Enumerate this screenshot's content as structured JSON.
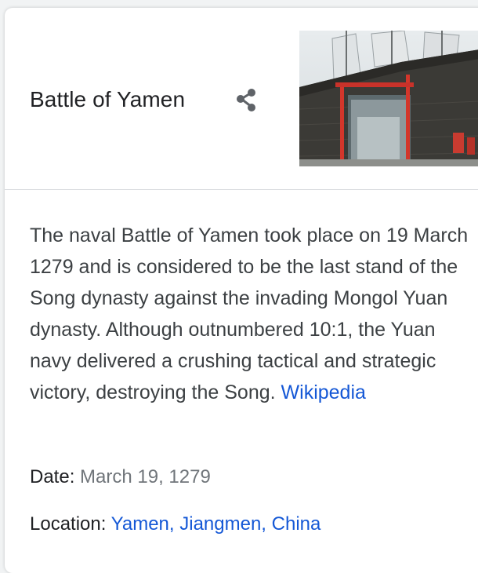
{
  "panel": {
    "title": "Battle of Yamen",
    "share_icon": "share-icon",
    "image_alt": "Yamen battle site gate"
  },
  "description": {
    "text": "The naval Battle of Yamen took place on 19 March 1279 and is considered to be the last stand of the Song dynasty against the invading Mongol Yuan dynasty. Although outnumbered 10:1, the Yuan navy delivered a crushing tactical and strategic victory, destroying the Song.",
    "source_link": "Wikipedia"
  },
  "facts": {
    "date_label": "Date:",
    "date_value": "March 19, 1279",
    "location_label": "Location:",
    "location_value": "Yamen, Jiangmen, China"
  },
  "colors": {
    "link": "#1558d6",
    "text": "#3c4043",
    "muted": "#70757a"
  }
}
